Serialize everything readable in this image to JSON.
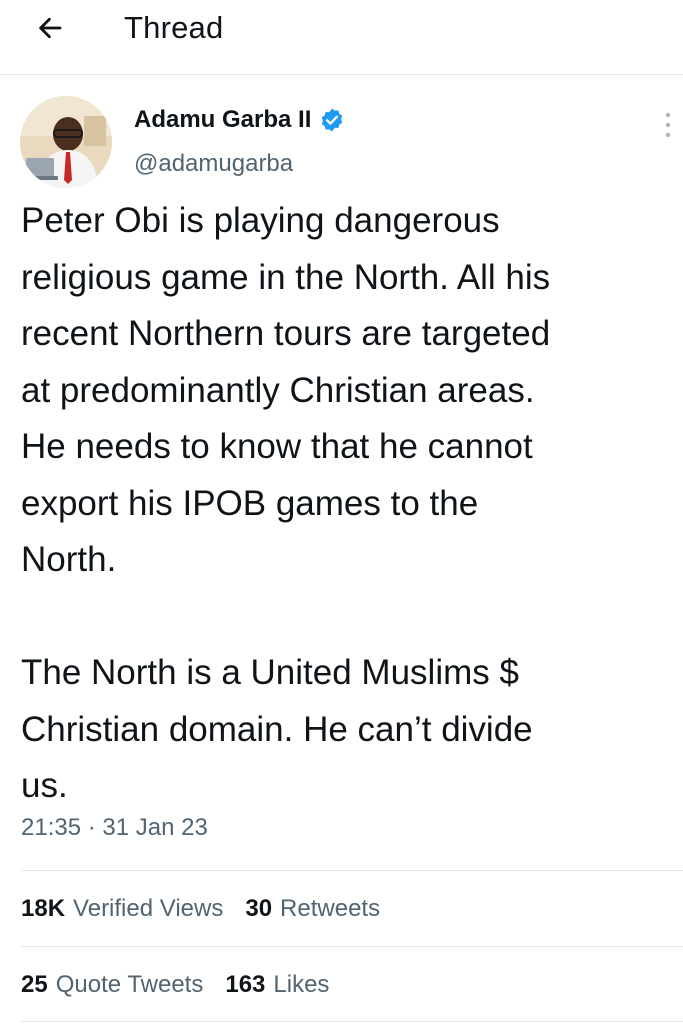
{
  "header": {
    "title": "Thread",
    "back_icon": "arrow-left-icon"
  },
  "tweet": {
    "author_name": "Adamu Garba II",
    "handle": "@adamugarba",
    "verified": true,
    "verified_color": "#1d9bf0",
    "text": "Peter Obi is playing dangerous\nreligious game in the North. All his\nrecent Northern tours are targeted\nat predominantly Christian areas.\nHe needs to know that he cannot\nexport his IPOB games to the\nNorth.\n\nThe North is a United Muslims $\nChristian domain. He can’t divide\nus.",
    "timestamp": "21:35 · 31 Jan 23"
  },
  "stats": {
    "views_count": "18K",
    "views_label": "Verified Views",
    "retweets_count": "30",
    "retweets_label": "Retweets",
    "quotes_count": "25",
    "quotes_label": "Quote Tweets",
    "likes_count": "163",
    "likes_label": "Likes"
  },
  "colors": {
    "text_primary": "#0f1419",
    "text_secondary": "#536471",
    "divider": "#e7e9ea",
    "accent": "#1d9bf0"
  }
}
